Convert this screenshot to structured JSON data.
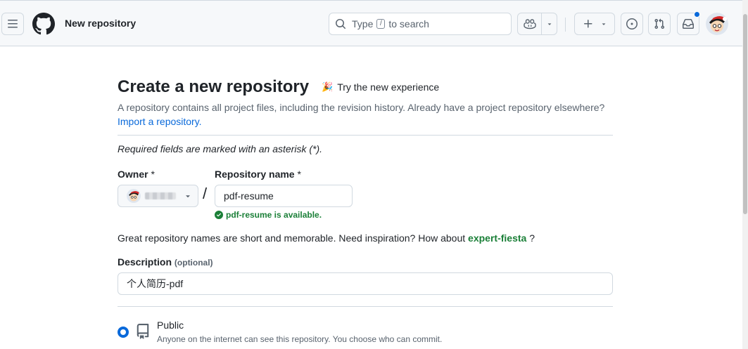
{
  "header": {
    "page_context": "New repository",
    "search": {
      "prefix": "Type",
      "key": "/",
      "suffix": "to search"
    }
  },
  "page": {
    "title": "Create a new repository",
    "new_experience": "Try the new experience",
    "intro": "A repository contains all project files, including the revision history. Already have a project repository elsewhere?",
    "import_link": "Import a repository.",
    "required_note": "Required fields are marked with an asterisk (*)."
  },
  "form": {
    "owner_label": "Owner",
    "repo_label": "Repository name",
    "required_mark": "*",
    "slash": "/",
    "repo_name_value": "pdf-resume",
    "availability": "pdf-resume is available.",
    "suggestion_prefix": "Great repository names are short and memorable. Need inspiration? How about",
    "suggestion_name": "expert-fiesta",
    "suggestion_suffix": "?",
    "description_label": "Description",
    "description_optional": "(optional)",
    "description_value": "个人简历-pdf"
  },
  "visibility": {
    "public_title": "Public",
    "public_desc": "Anyone on the internet can see this repository. You choose who can commit."
  },
  "colors": {
    "accent": "#0969da",
    "success": "#1a7f37",
    "border": "#d1d9e0",
    "header_bg": "#f6f8fa"
  }
}
